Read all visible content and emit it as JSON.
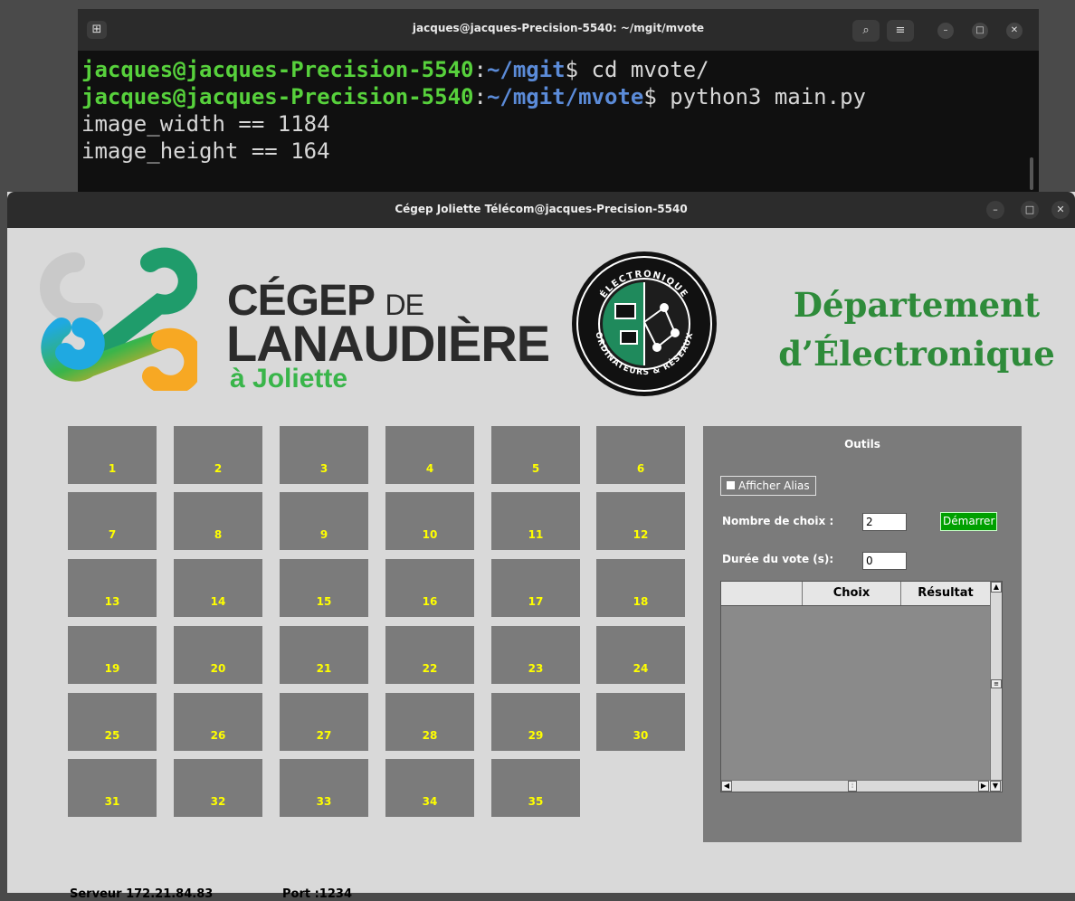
{
  "terminal": {
    "title": "jacques@jacques-Precision-5540: ~/mgit/mvote",
    "lines": [
      {
        "user": "jacques@jacques-Precision-5540",
        "sep": ":",
        "path": "~/mgit",
        "prompt": "$",
        "cmd": " cd mvote/"
      },
      {
        "user": "jacques@jacques-Precision-5540",
        "sep": ":",
        "path": "~/mgit/mvote",
        "prompt": "$",
        "cmd": " python3 main.py"
      }
    ],
    "output": [
      "image_width == 1184",
      "image_height == 164"
    ]
  },
  "app": {
    "title": "Cégep Joliette Télécom@jacques-Precision-5540",
    "logo": {
      "line1": "CÉGEP",
      "line1_suffix": "DE",
      "line2": "LANAUDIÈRE",
      "line3": "à Joliette"
    },
    "seal": {
      "top": "ÉLECTRONIQUE",
      "bottom": "ORDINATEURS & RÉSEAUX"
    },
    "department": {
      "line1": "Département",
      "line2": "d’Électronique"
    },
    "voters": [
      "1",
      "2",
      "3",
      "4",
      "5",
      "6",
      "7",
      "8",
      "9",
      "10",
      "11",
      "12",
      "13",
      "14",
      "15",
      "16",
      "17",
      "18",
      "19",
      "20",
      "21",
      "22",
      "23",
      "24",
      "25",
      "26",
      "27",
      "28",
      "29",
      "30",
      "31",
      "32",
      "33",
      "34",
      "35"
    ],
    "tools": {
      "title": "Outils",
      "alias_label": "Afficher Alias",
      "choices_label": "Nombre de choix :",
      "choices_value": "2",
      "start_label": "Démarrer",
      "duration_label": "Durée du vote (s):",
      "duration_value": "0",
      "columns": [
        "",
        "Choix",
        "Résultat"
      ]
    },
    "footer": {
      "server": "Serveur 172.21.84.83",
      "port": "Port :1234"
    }
  },
  "colors": {
    "voter_bg": "#7b7b7b",
    "voter_text": "#ffff00",
    "dept_green": "#2e8b3a",
    "start_green": "#00a000"
  }
}
